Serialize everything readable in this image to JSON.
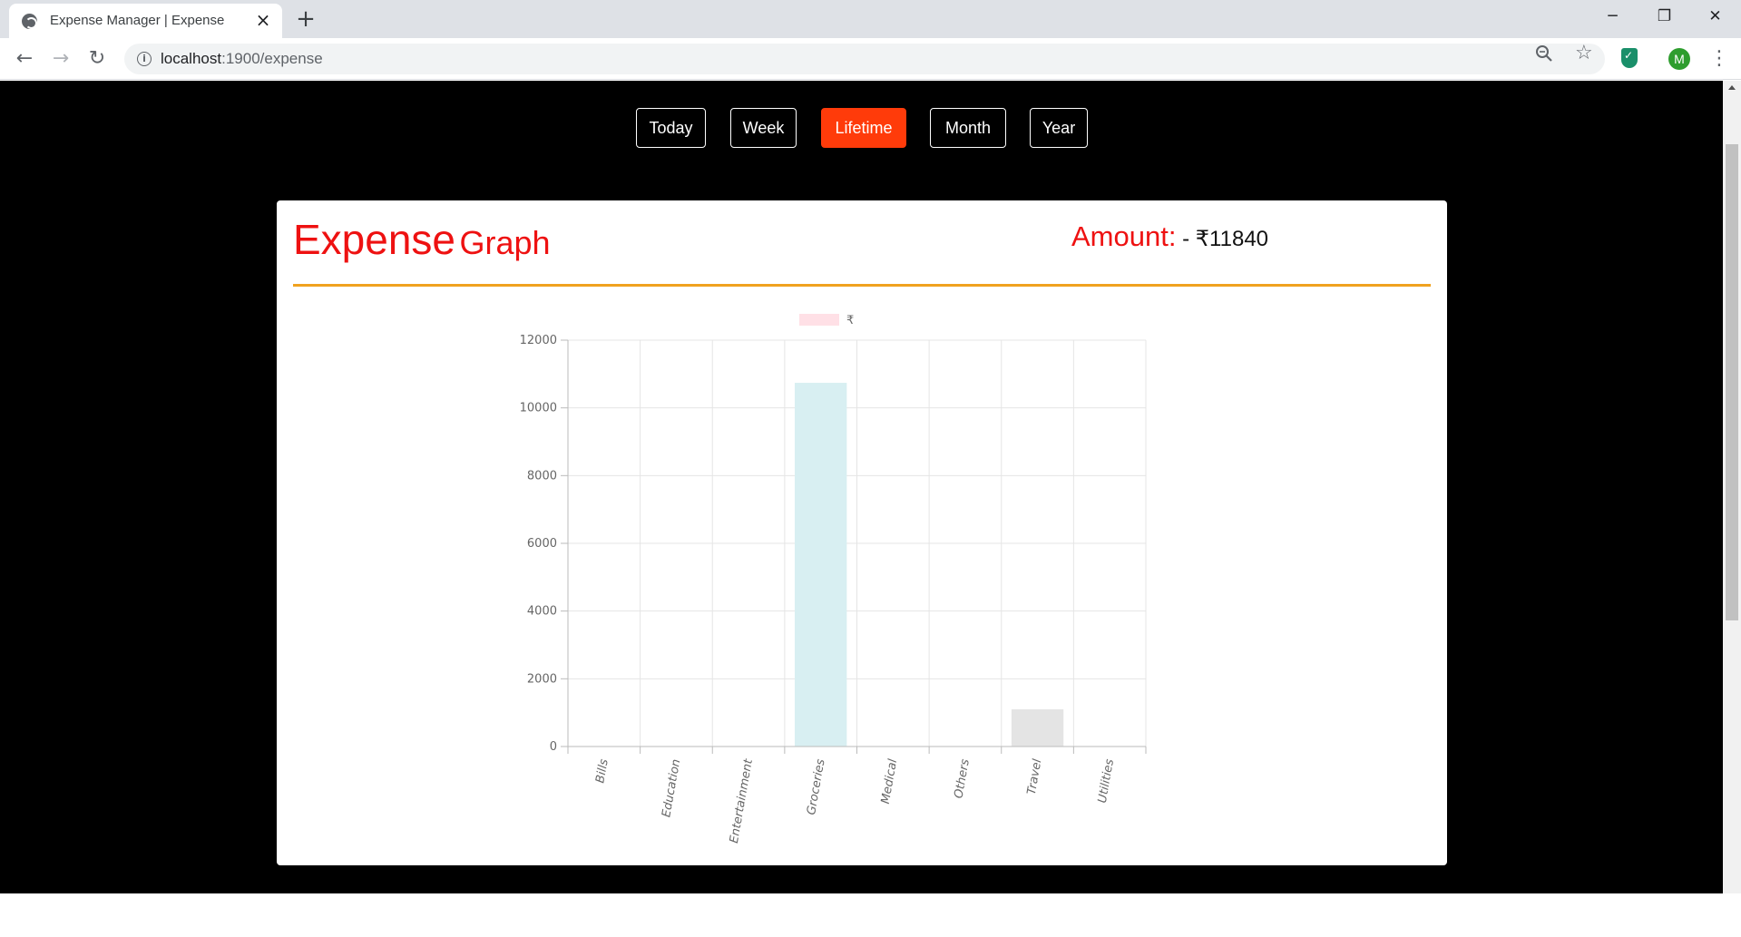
{
  "browser": {
    "tab_title": "Expense Manager | Expense",
    "url_host": "localhost",
    "url_path": ":1900/expense",
    "profile_initial": "M",
    "icons": {
      "favicon": "globe-icon",
      "close": "close-icon",
      "new_tab": "plus-icon",
      "back": "arrow-left-icon",
      "forward": "arrow-right-icon",
      "reload": "reload-icon",
      "site_info": "info-icon",
      "zoom": "magnifier-icon",
      "bookmark": "star-icon",
      "extension": "shield-icon",
      "menu": "kebab-menu-icon"
    }
  },
  "periods": [
    {
      "label": "Today",
      "active": false
    },
    {
      "label": "Week",
      "active": false
    },
    {
      "label": "Lifetime",
      "active": true
    },
    {
      "label": "Month",
      "active": false
    },
    {
      "label": "Year",
      "active": false
    }
  ],
  "card": {
    "title_main": "Expense",
    "title_sub": "Graph",
    "amount_label": "Amount:",
    "amount_value": " - ₹11840"
  },
  "colors": {
    "accent": "#ff3b0a",
    "heading": "#ee1111",
    "divider": "#f0a21f",
    "page_background": "#000000"
  },
  "chart_data": {
    "type": "bar",
    "categories": [
      "Bills",
      "Education",
      "Entertainment",
      "Groceries",
      "Medical",
      "Others",
      "Travel",
      "Utilities"
    ],
    "series": [
      {
        "name": "₹",
        "values": [
          0,
          0,
          0,
          10740,
          0,
          0,
          1100,
          0
        ]
      }
    ],
    "bar_colors": [
      "#ffd7df",
      "#d6eaf8",
      "#fff2cc",
      "#d8eff2",
      "#e6dcff",
      "#ffe5cc",
      "#e4e4e4",
      "#fde2e4"
    ],
    "legend_color": "#ffe0e6",
    "ylim": [
      0,
      12000
    ],
    "yticks": [
      0,
      2000,
      4000,
      6000,
      8000,
      10000,
      12000
    ],
    "grid": true,
    "legend_position": "top"
  }
}
